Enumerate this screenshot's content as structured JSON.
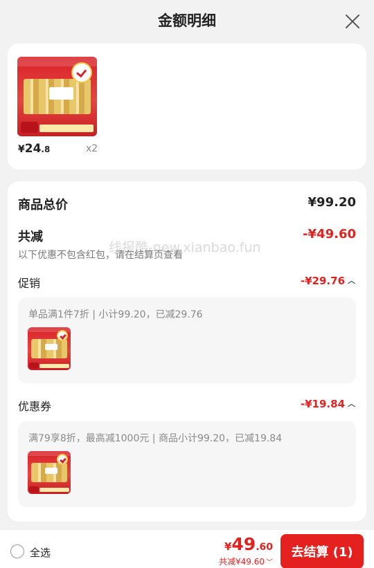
{
  "header": {
    "title": "金额明细"
  },
  "product": {
    "price_currency": "¥",
    "price_int": "24",
    "price_dec": ".8",
    "quantity": "x2"
  },
  "summary": {
    "total_label": "商品总价",
    "total_value": "¥99.20",
    "discount_label": "共减",
    "discount_value": "-¥49.60",
    "note": "以下优惠不包含红包，请在结算页查看"
  },
  "promotion": {
    "label": "促销",
    "value": "-¥29.76",
    "detail": "单品满1件7折 | 小计99.20，已减29.76"
  },
  "coupon": {
    "label": "优惠券",
    "value": "-¥19.84",
    "detail": "满79享8折，最高减1000元 | 商品小计99.20，已减19.84"
  },
  "watermark": "线报酷-new.xianbao.fun",
  "footer": {
    "select_all": "全选",
    "price_currency": "¥",
    "price_int": "49",
    "price_dec": ".60",
    "total_discount": "共减¥49.60",
    "checkout_label": "去结算 (1)"
  },
  "colors": {
    "accent": "#e4211f",
    "background": "#f2f2f2"
  },
  "icons": [
    "close-icon",
    "chevron-up-icon",
    "chevron-down-icon",
    "radio-circle-icon"
  ]
}
